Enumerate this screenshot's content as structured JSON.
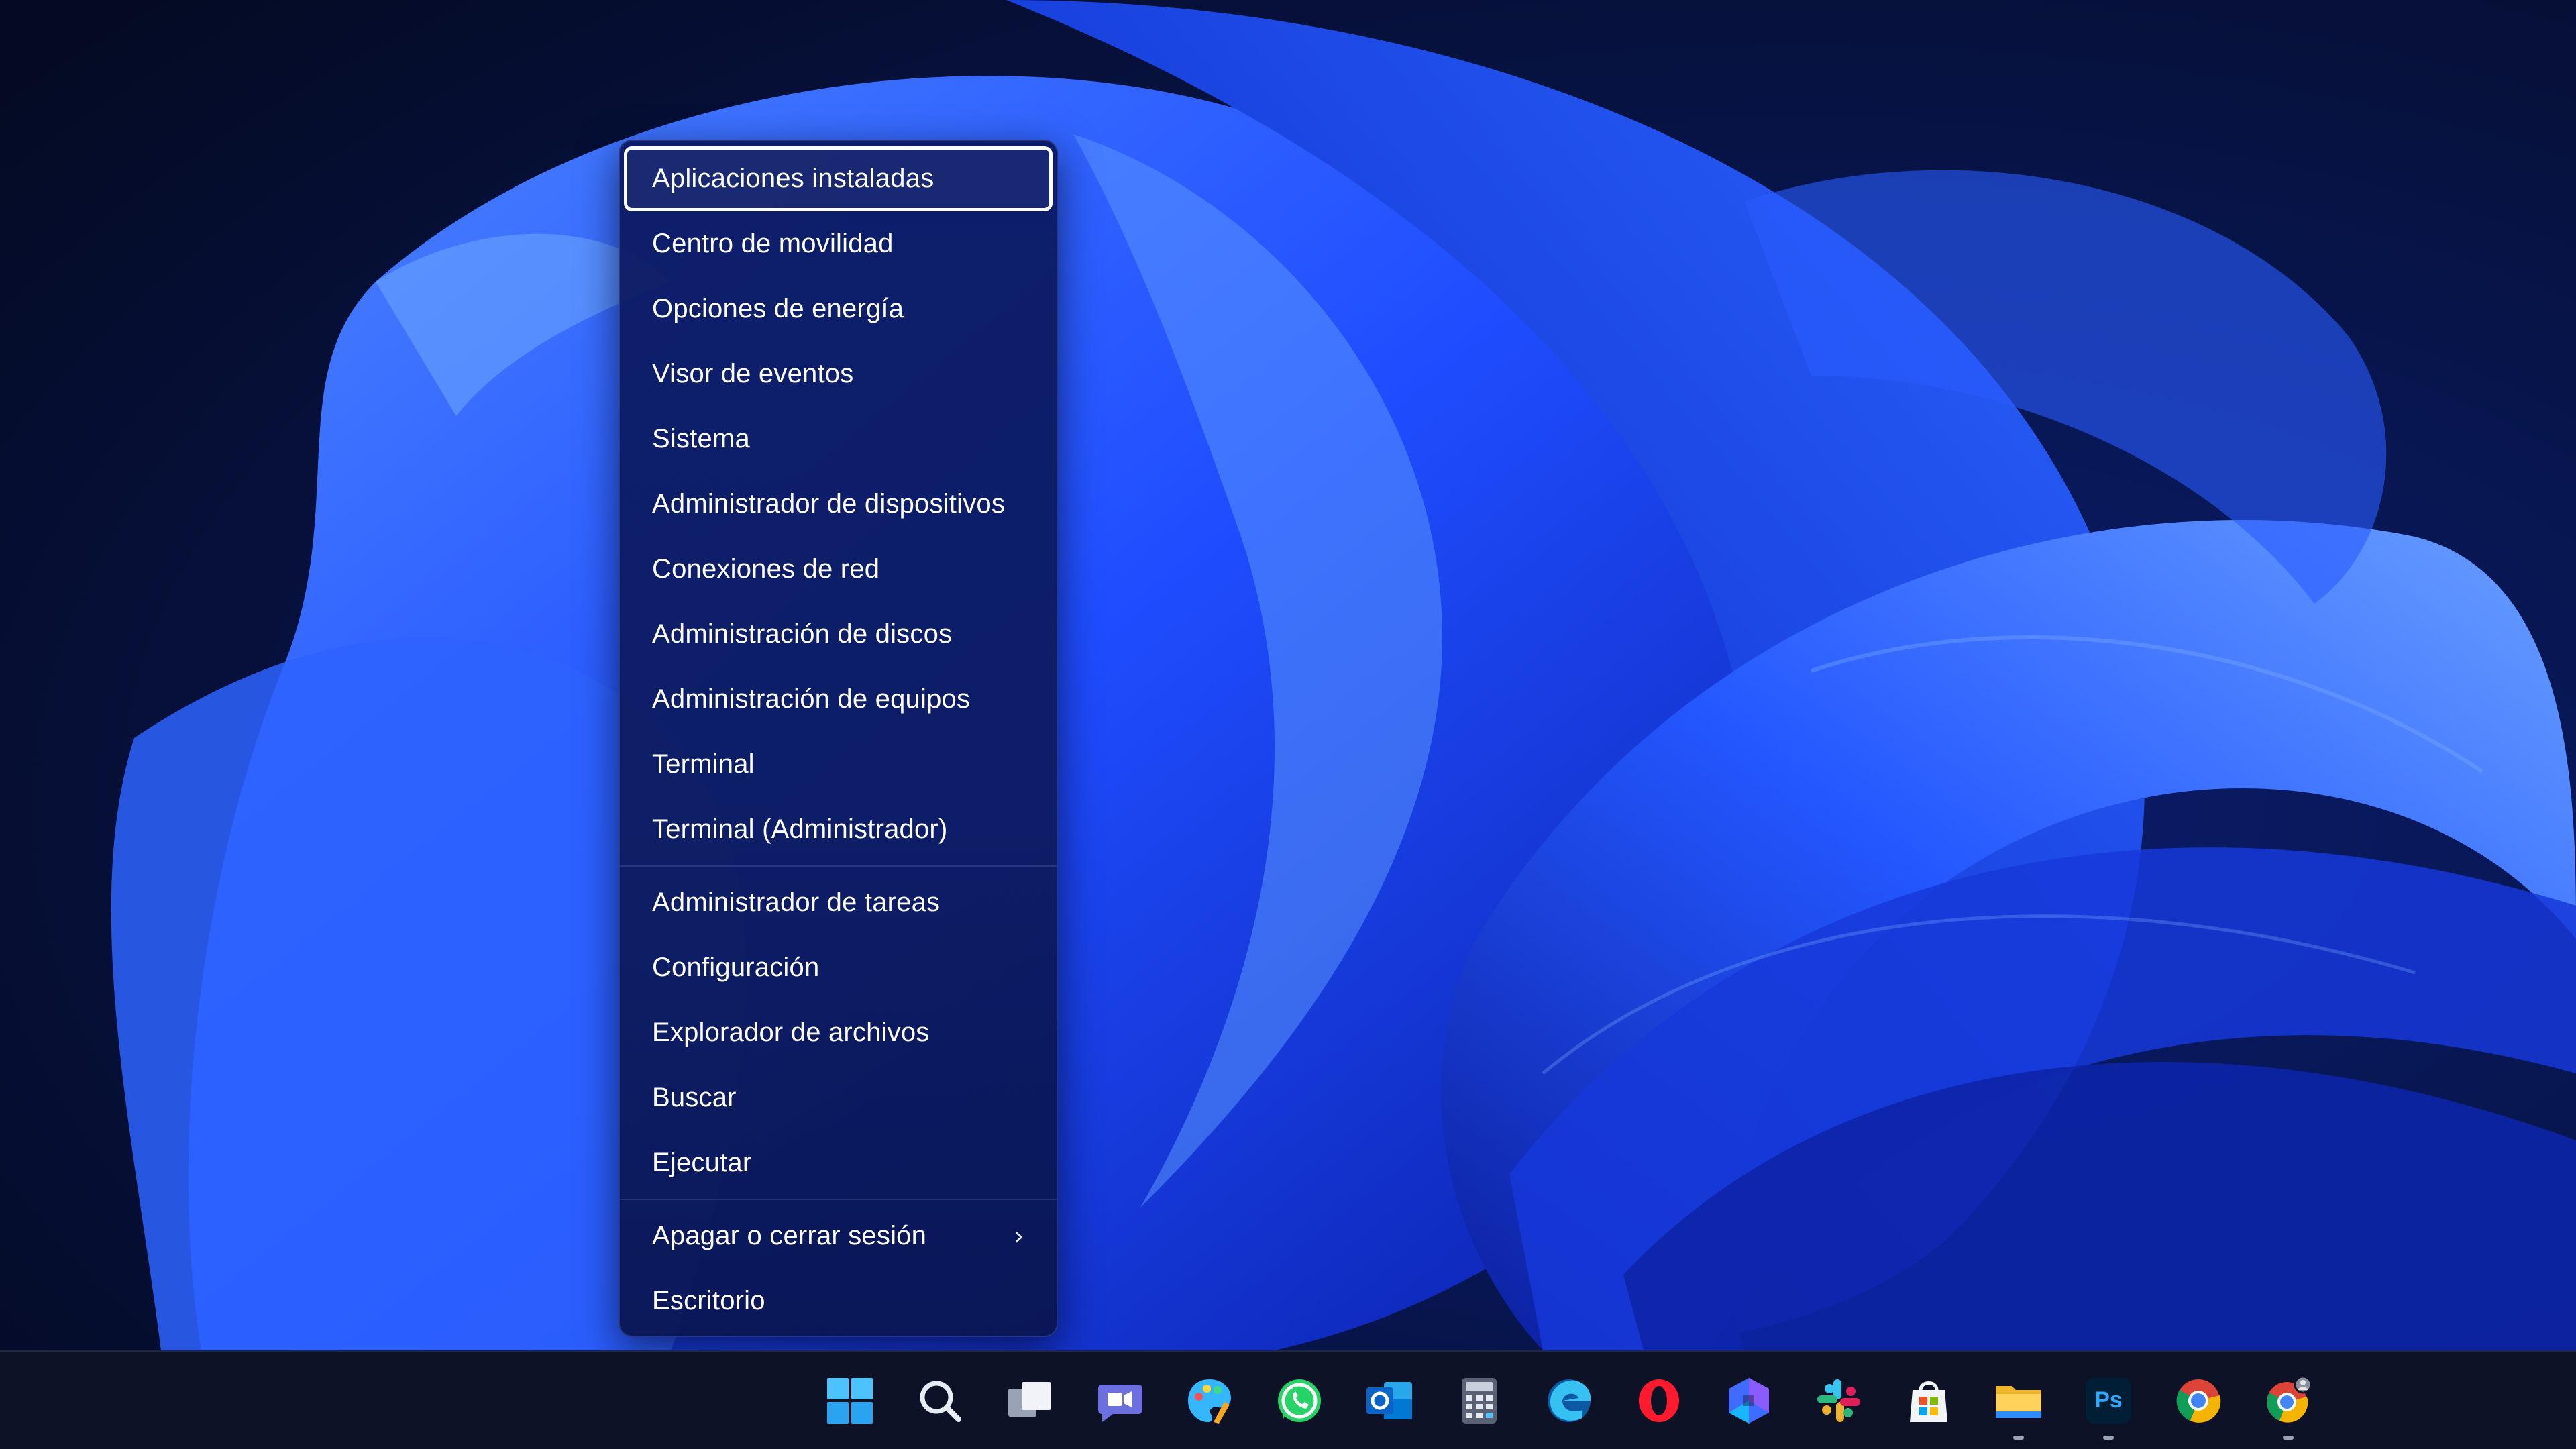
{
  "context_menu": {
    "items": [
      {
        "label": "Aplicaciones instaladas",
        "focused": true
      },
      {
        "label": "Centro de movilidad"
      },
      {
        "label": "Opciones de energía"
      },
      {
        "label": "Visor de eventos"
      },
      {
        "label": "Sistema"
      },
      {
        "label": "Administrador de dispositivos"
      },
      {
        "label": "Conexiones de red"
      },
      {
        "label": "Administración de discos"
      },
      {
        "label": "Administración de equipos"
      },
      {
        "label": "Terminal"
      },
      {
        "label": "Terminal (Administrador)"
      },
      {
        "label": "Administrador de tareas"
      },
      {
        "label": "Configuración"
      },
      {
        "label": "Explorador de archivos"
      },
      {
        "label": "Buscar"
      },
      {
        "label": "Ejecutar"
      },
      {
        "label": "Apagar o cerrar sesión",
        "has_submenu": true
      },
      {
        "label": "Escritorio"
      }
    ],
    "submenu_glyph": "›"
  },
  "taskbar": {
    "icons": [
      {
        "name": "start-windows-icon"
      },
      {
        "name": "search-icon"
      },
      {
        "name": "task-view-icon"
      },
      {
        "name": "teams-chat-icon"
      },
      {
        "name": "paint-icon"
      },
      {
        "name": "whatsapp-icon"
      },
      {
        "name": "outlook-icon"
      },
      {
        "name": "calculator-icon"
      },
      {
        "name": "edge-icon"
      },
      {
        "name": "opera-icon"
      },
      {
        "name": "copilot-icon"
      },
      {
        "name": "slack-icon"
      },
      {
        "name": "microsoft-store-icon"
      },
      {
        "name": "file-explorer-icon",
        "running": true
      },
      {
        "name": "photoshop-icon",
        "running": true,
        "text": "Ps"
      },
      {
        "name": "chrome-icon"
      },
      {
        "name": "chrome-profile-icon",
        "running": true
      }
    ]
  },
  "colors": {
    "menu_text": "#ffffff",
    "focus_ring": "#ffffff",
    "taskbar_bg": "#0e1226",
    "wallpaper_accent": "#1f4dff"
  }
}
